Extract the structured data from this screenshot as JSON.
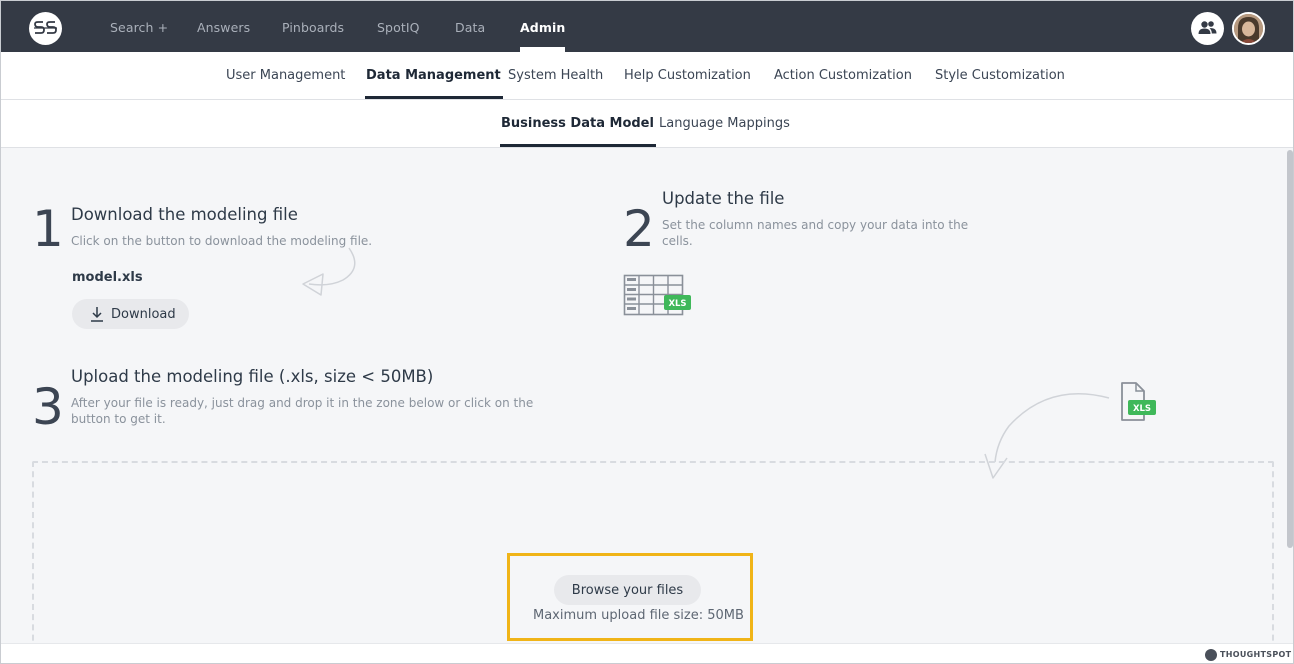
{
  "topnav": {
    "items": [
      {
        "label": "Search +",
        "active": false
      },
      {
        "label": "Answers",
        "active": false
      },
      {
        "label": "Pinboards",
        "active": false
      },
      {
        "label": "SpotIQ",
        "active": false
      },
      {
        "label": "Data",
        "active": false
      },
      {
        "label": "Admin",
        "active": true
      }
    ],
    "logo_icon": "thoughtspot-logo-icon",
    "people_icon": "people-icon",
    "avatar_icon": "user-avatar"
  },
  "admin_tabs": [
    {
      "label": "User Management",
      "active": false
    },
    {
      "label": "Data Management",
      "active": true
    },
    {
      "label": "System Health",
      "active": false
    },
    {
      "label": "Help Customization",
      "active": false
    },
    {
      "label": "Action Customization",
      "active": false
    },
    {
      "label": "Style Customization",
      "active": false
    }
  ],
  "sub_tabs": [
    {
      "label": "Business Data Model",
      "active": true
    },
    {
      "label": "Language Mappings",
      "active": false
    }
  ],
  "steps": {
    "one": {
      "number": "1",
      "title": "Download the modeling file",
      "description": "Click on the button to download the modeling file.",
      "filename": "model.xls",
      "button_label": "Download"
    },
    "two": {
      "number": "2",
      "title": "Update the file",
      "description": "Set the column names and copy your data into the cells.",
      "badge": "XLS"
    },
    "three": {
      "number": "3",
      "title": "Upload the modeling file (.xls, size < 50MB)",
      "description": "After your file is ready, just drag and drop it in the zone below or click on the button to get it.",
      "badge": "XLS"
    }
  },
  "dropzone": {
    "browse_label": "Browse your files",
    "max_size": "Maximum upload file size: 50MB"
  },
  "footer": {
    "brand": "THOUGHTSPOT"
  },
  "colors": {
    "topnav_bg": "#343a45",
    "content_bg": "#f5f6f8",
    "xls_green": "#3fb85a",
    "highlight": "#f0b418"
  }
}
